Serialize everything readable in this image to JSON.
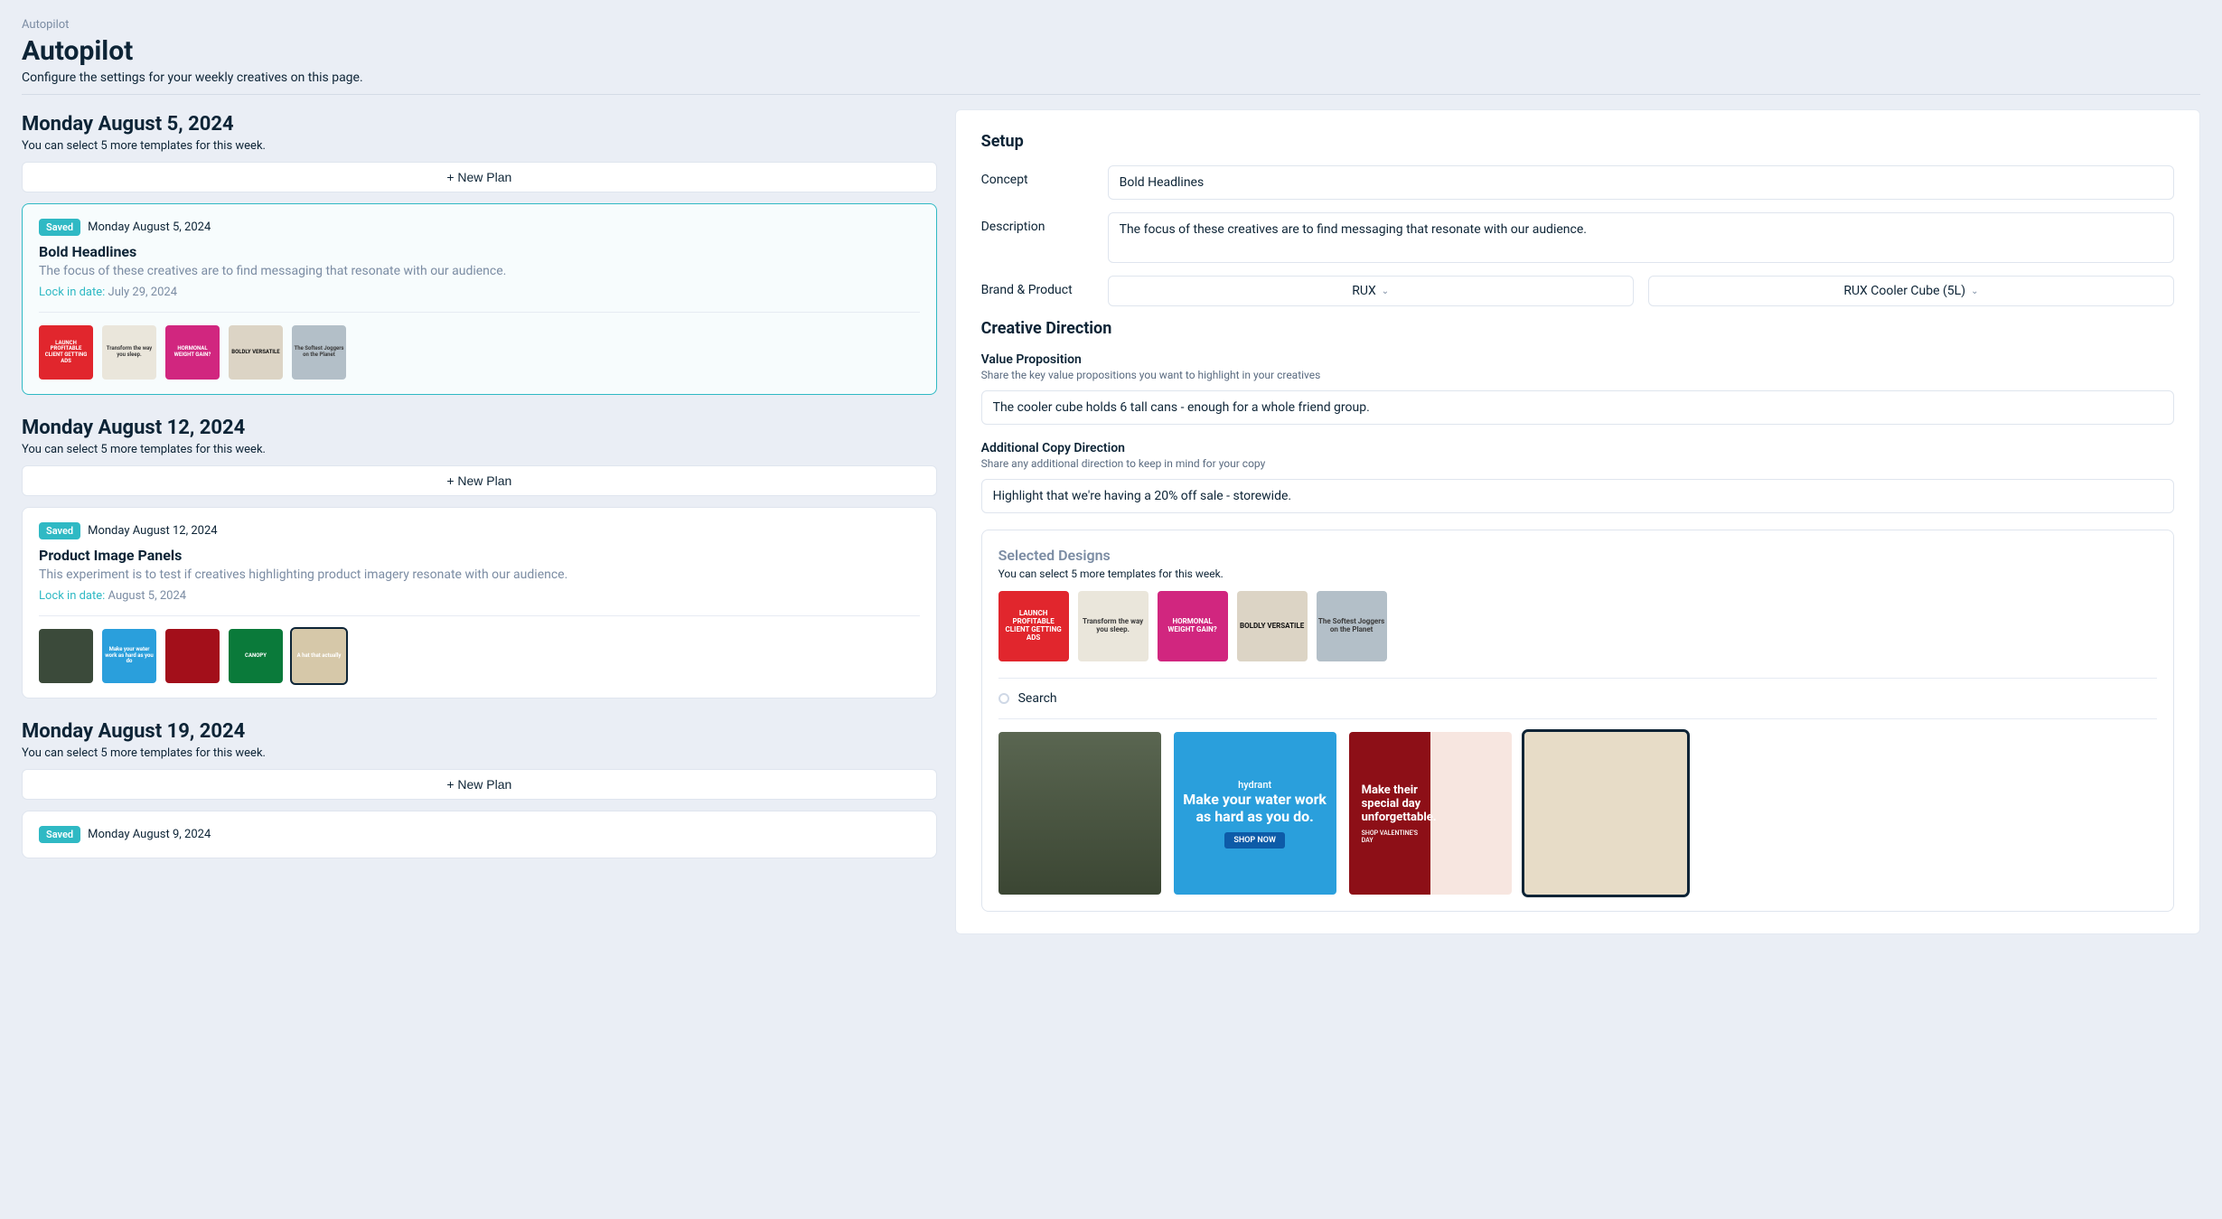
{
  "breadcrumb": "Autopilot",
  "page_title": "Autopilot",
  "page_sub": "Configure the settings for your weekly creatives on this page.",
  "weeks": [
    {
      "title": "Monday August 5, 2024",
      "sub": "You can select 5 more templates for this week.",
      "new_plan": "+ New Plan",
      "plan": {
        "badge": "Saved",
        "date": "Monday August 5, 2024",
        "title": "Bold Headlines",
        "desc": "The focus of these creatives are to find messaging that resonate with our audience.",
        "lock_label": "Lock in date:",
        "lock_date": "July 29, 2024",
        "selected": true,
        "thumbs": [
          "LAUNCH PROFITABLE CLIENT GETTING ADS",
          "Transform the way you sleep.",
          "HORMONAL WEIGHT GAIN?",
          "BOLDLY VERSATILE",
          "The Softest Joggers on the Planet"
        ]
      }
    },
    {
      "title": "Monday August 12, 2024",
      "sub": "You can select 5 more templates for this week.",
      "new_plan": "+ New Plan",
      "plan": {
        "badge": "Saved",
        "date": "Monday August 12, 2024",
        "title": "Product Image Panels",
        "desc": "This experiment is to test if creatives highlighting product imagery resonate with our audience.",
        "lock_label": "Lock in date:",
        "lock_date": "August 5, 2024",
        "selected": false,
        "thumbs": [
          "",
          "Make your water work as hard as you do",
          "",
          "CANOPY",
          "A hat that actually"
        ]
      }
    },
    {
      "title": "Monday August 19, 2024",
      "sub": "You can select 5 more templates for this week.",
      "new_plan": "+ New Plan",
      "plan": {
        "badge": "Saved",
        "date": "Monday August 9, 2024",
        "title": "",
        "desc": "",
        "lock_label": "",
        "lock_date": "",
        "selected": false,
        "thumbs": []
      }
    }
  ],
  "setup": {
    "heading": "Setup",
    "concept_label": "Concept",
    "concept_value": "Bold Headlines",
    "desc_label": "Description",
    "desc_value": "The focus of these creatives are to find messaging that resonate with our audience.",
    "bp_label": "Brand & Product",
    "brand_value": "RUX",
    "product_value": "RUX  Cooler Cube (5L)"
  },
  "creative": {
    "heading": "Creative Direction",
    "vp_h": "Value Proposition",
    "vp_sub": "Share the key value propositions you want to highlight in your creatives",
    "vp_value": "The cooler cube holds 6 tall cans - enough for a whole friend group.",
    "copy_h": "Additional Copy Direction",
    "copy_sub": "Share any additional direction to keep in mind for your copy",
    "copy_value": "Highlight that we're having a 20% off sale - storewide."
  },
  "designs": {
    "heading": "Selected Designs",
    "sub": "You can select 5 more templates for this week.",
    "thumbs": [
      "LAUNCH PROFITABLE CLIENT GETTING ADS",
      "Transform the way you sleep.",
      "HORMONAL WEIGHT GAIN?",
      "BOLDLY VERSATILE",
      "The Softest Joggers on the Planet"
    ],
    "search_label": "Search",
    "grid": {
      "hydrant_brand": "hydrant",
      "hydrant_text": "Make your water work as hard as you do.",
      "hydrant_btn": "SHOP NOW",
      "roses_text": "Make their special day unforgettable.",
      "roses_sub": "SHOP VALENTINE'S DAY"
    }
  }
}
